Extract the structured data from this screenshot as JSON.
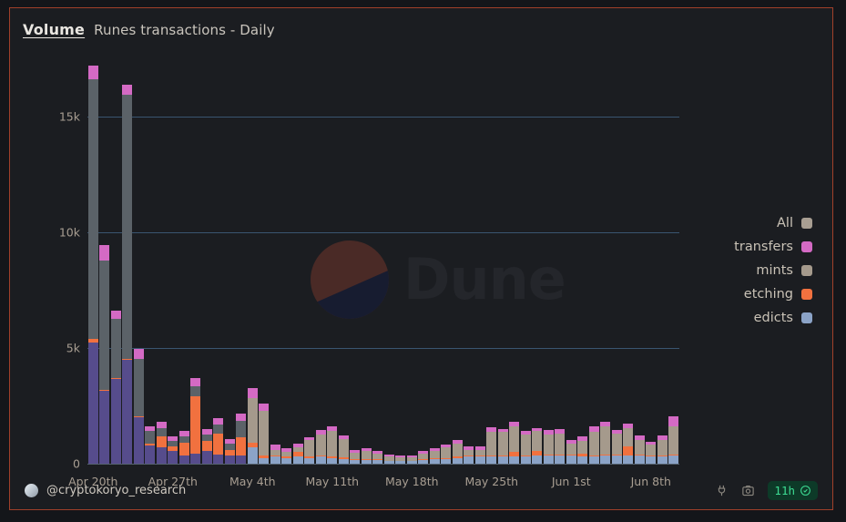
{
  "header": {
    "title": "Volume",
    "subtitle": "Runes transactions - Daily"
  },
  "watermark": {
    "text": "Dune"
  },
  "legend": {
    "items": [
      {
        "label": "All",
        "color": "#a89e92"
      },
      {
        "label": "transfers",
        "color": "#d46ac4"
      },
      {
        "label": "mints",
        "color": "#a59a8c"
      },
      {
        "label": "etching",
        "color": "#f1713f"
      },
      {
        "label": "edicts",
        "color": "#8ba3c7"
      }
    ]
  },
  "footer": {
    "handle": "@cryptokoryo_research",
    "refresh_badge": "11h",
    "icons": [
      "plug-icon",
      "camera-icon",
      "check-circle-icon"
    ]
  },
  "chart_data": {
    "type": "bar",
    "stacked": true,
    "title": "Runes transactions - Daily",
    "xlabel": "",
    "ylabel": "Volume",
    "ylim": [
      0,
      17500
    ],
    "yticks": [
      0,
      5000,
      10000,
      15000
    ],
    "ytick_labels": [
      "0",
      "5k",
      "10k",
      "15k"
    ],
    "grid": true,
    "legend_position": "right",
    "xtick_labels": [
      "Apr 20th",
      "Apr 27th",
      "May 4th",
      "May 11th",
      "May 18th",
      "May 25th",
      "Jun 1st",
      "Jun 8th"
    ],
    "xtick_indices": [
      0,
      7,
      14,
      21,
      28,
      35,
      42,
      49
    ],
    "colors": {
      "edicts": "#564c8c",
      "etching": "#f1713f",
      "mints": "#5b6268",
      "transfers": "#d46ac4"
    },
    "late_colors": {
      "edicts": "#8ba3c7",
      "mints": "#a59a8c"
    },
    "categories": [
      "Apr 20th",
      "Apr 21st",
      "Apr 22nd",
      "Apr 23rd",
      "Apr 24th",
      "Apr 25th",
      "Apr 26th",
      "Apr 27th",
      "Apr 28th",
      "Apr 29th",
      "Apr 30th",
      "May 1st",
      "May 2nd",
      "May 3rd",
      "May 4th",
      "May 5th",
      "May 6th",
      "May 7th",
      "May 8th",
      "May 9th",
      "May 10th",
      "May 11th",
      "May 12th",
      "May 13th",
      "May 14th",
      "May 15th",
      "May 16th",
      "May 17th",
      "May 18th",
      "May 19th",
      "May 20th",
      "May 21st",
      "May 22nd",
      "May 23rd",
      "May 24th",
      "May 25th",
      "May 26th",
      "May 27th",
      "May 28th",
      "May 29th",
      "May 30th",
      "May 31st",
      "Jun 1st",
      "Jun 2nd",
      "Jun 3rd",
      "Jun 4th",
      "Jun 5th",
      "Jun 6th",
      "Jun 7th",
      "Jun 8th",
      "Jun 9th",
      "Jun 10th"
    ],
    "series": [
      {
        "name": "edicts",
        "values": [
          5250,
          3150,
          3650,
          4500,
          2000,
          800,
          700,
          550,
          350,
          450,
          550,
          400,
          350,
          350,
          700,
          250,
          300,
          250,
          300,
          250,
          300,
          250,
          200,
          150,
          150,
          150,
          100,
          100,
          100,
          150,
          200,
          200,
          250,
          300,
          300,
          300,
          300,
          300,
          300,
          350,
          350,
          350,
          350,
          300,
          300,
          350,
          350,
          350,
          350,
          300,
          300,
          350
        ]
      },
      {
        "name": "etching",
        "values": [
          150,
          50,
          50,
          30,
          30,
          60,
          500,
          200,
          550,
          2450,
          450,
          900,
          250,
          800,
          200,
          100,
          60,
          60,
          200,
          60,
          60,
          60,
          60,
          40,
          40,
          40,
          30,
          30,
          30,
          40,
          40,
          40,
          60,
          60,
          60,
          60,
          60,
          200,
          60,
          200,
          60,
          60,
          60,
          150,
          60,
          60,
          60,
          400,
          60,
          60,
          60,
          60
        ]
      },
      {
        "name": "mints",
        "values": [
          11200,
          5600,
          2550,
          11400,
          2500,
          550,
          350,
          250,
          300,
          450,
          250,
          400,
          250,
          700,
          1950,
          1950,
          250,
          200,
          200,
          700,
          900,
          1100,
          800,
          300,
          350,
          250,
          200,
          150,
          150,
          250,
          300,
          450,
          550,
          250,
          250,
          1000,
          1000,
          1100,
          900,
          850,
          850,
          900,
          450,
          550,
          1000,
          1200,
          900,
          800,
          600,
          450,
          650,
          1200
        ]
      },
      {
        "name": "transfers",
        "values": [
          600,
          650,
          350,
          450,
          450,
          200,
          250,
          200,
          200,
          350,
          250,
          250,
          200,
          300,
          400,
          300,
          200,
          150,
          150,
          150,
          200,
          200,
          150,
          100,
          150,
          100,
          80,
          80,
          80,
          100,
          120,
          150,
          150,
          120,
          120,
          200,
          150,
          200,
          150,
          150,
          180,
          180,
          150,
          200,
          250,
          200,
          150,
          200,
          200,
          150,
          200,
          450
        ]
      }
    ]
  }
}
